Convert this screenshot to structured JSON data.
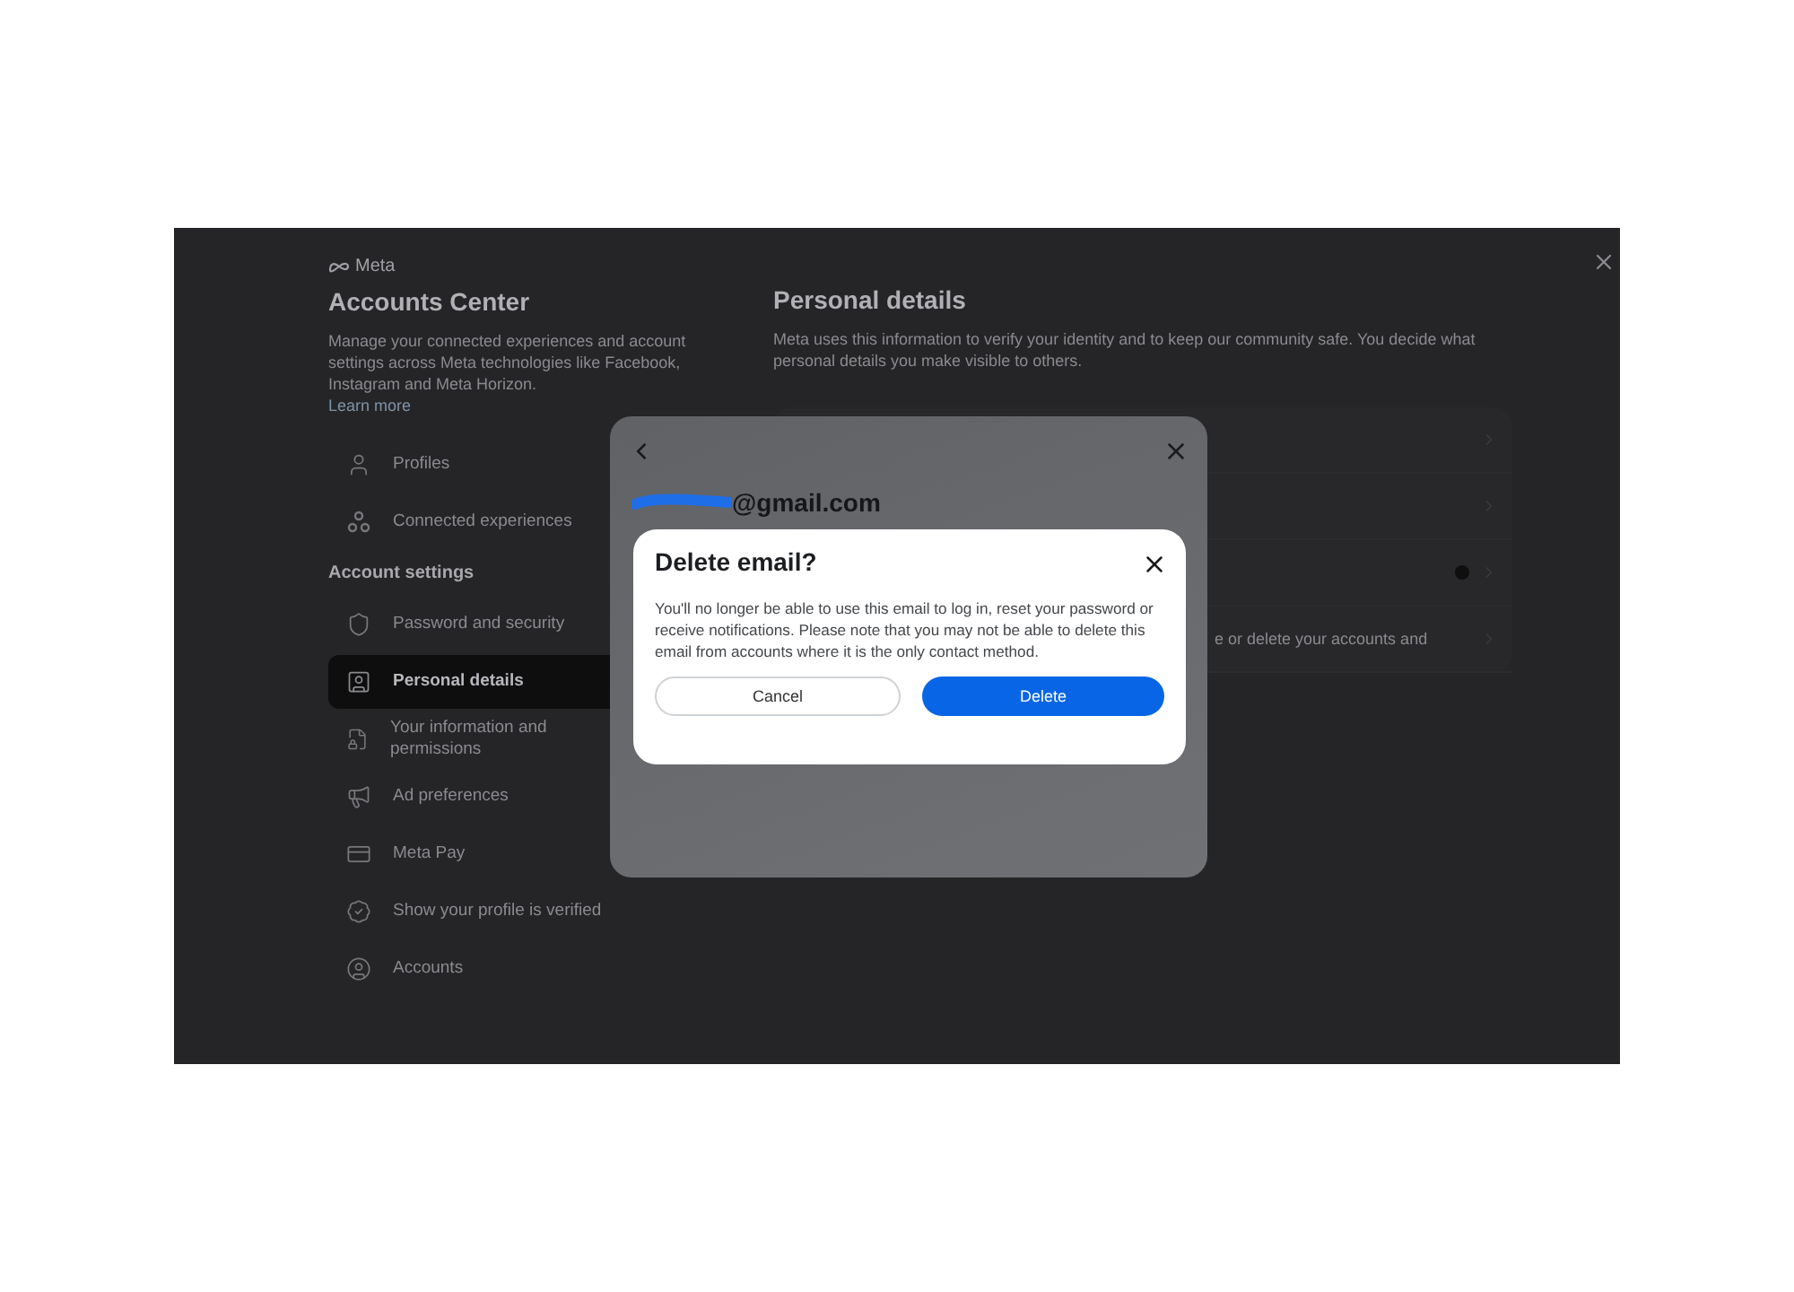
{
  "sidebar": {
    "brand": "Meta",
    "title": "Accounts Center",
    "description": "Manage your connected experiences and account settings across Meta technologies like Facebook, Instagram and Meta Horizon.",
    "link": "Learn more",
    "top_items": [
      {
        "label": "Profiles",
        "selected": false
      },
      {
        "label": "Connected experiences",
        "selected": false
      }
    ],
    "section_heading": "Account settings",
    "items": [
      {
        "label": "Password and security",
        "selected": false
      },
      {
        "label": "Personal details",
        "selected": true
      },
      {
        "label": "Your information and permissions",
        "selected": false
      },
      {
        "label": "Ad preferences",
        "selected": false
      },
      {
        "label": "Meta Pay",
        "selected": false
      },
      {
        "label": "Show your profile is verified",
        "selected": false
      },
      {
        "label": "Accounts",
        "selected": false
      }
    ]
  },
  "content": {
    "title": "Personal details",
    "description": "Meta uses this information to verify your identity and to keep our community safe. You decide what personal details you make visible to others.",
    "rows": [
      {
        "label": "",
        "badge": false
      },
      {
        "label": "",
        "badge": false
      },
      {
        "label": "",
        "badge": true
      },
      {
        "label": "e or delete your accounts and",
        "badge": false
      }
    ]
  },
  "email_dialog": {
    "email": "@gmail.com"
  },
  "confirm_dialog": {
    "title": "Delete email?",
    "message": "You'll no longer be able to use this email to log in, reset your password or receive notifications. Please note that you may not be able to delete this email from accounts where it is the only contact method.",
    "buttons": [
      {
        "label": "Cancel",
        "kind": "secondary"
      },
      {
        "label": "Delete",
        "kind": "primary"
      }
    ]
  }
}
